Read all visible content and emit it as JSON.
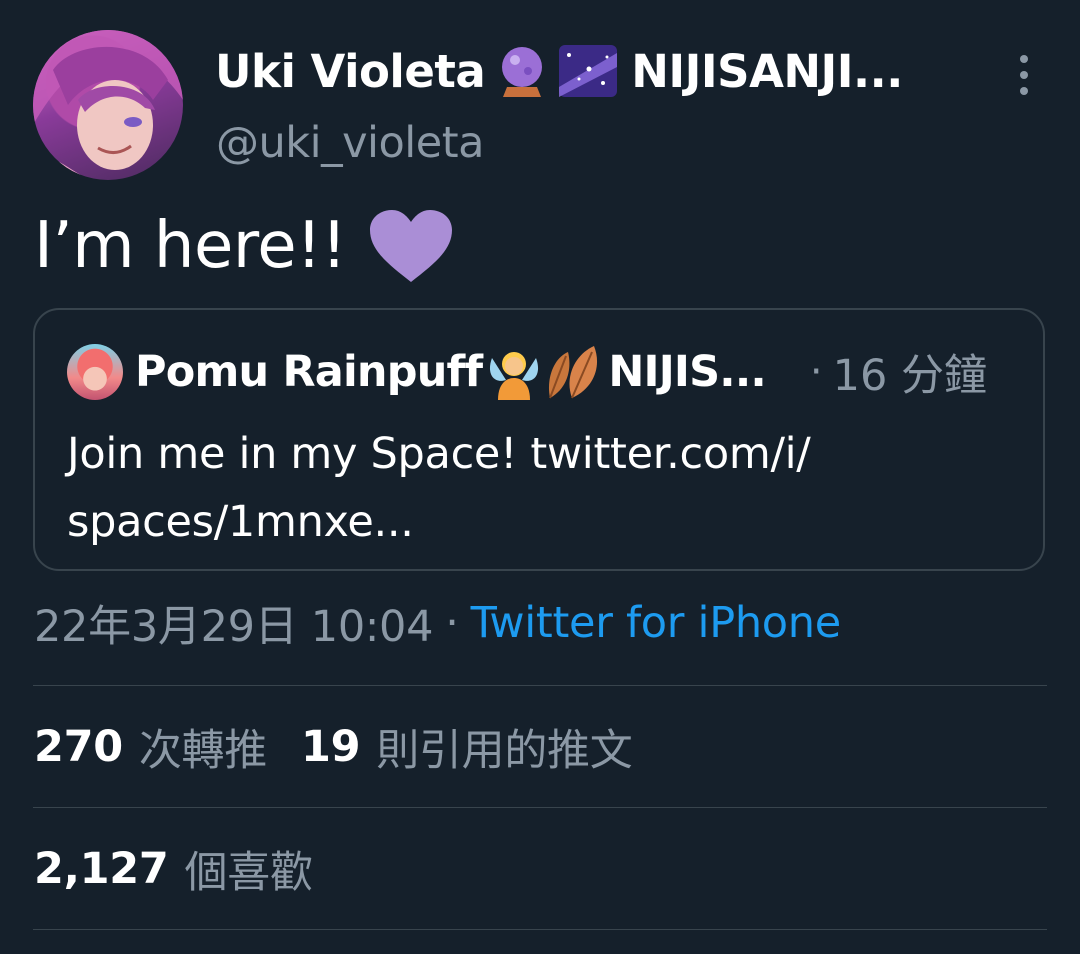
{
  "author": {
    "display_name": "Uki Violeta",
    "org": "NIJISANJI...",
    "handle": "@uki_violeta",
    "emoji": [
      "crystal-ball-icon",
      "milky-way-icon"
    ]
  },
  "tweet": {
    "text": "I’m here!!",
    "emoji": "purple-heart-icon"
  },
  "quoted": {
    "name": "Pomu Rainpuff",
    "org": "NIJIS...",
    "separator": "·",
    "time": "16 分鐘",
    "body_line1": "Join me in my Space! twitter.com/i/",
    "body_line2": "spaces/1mnxe...",
    "emoji": [
      "fairy-icon",
      "fallen-leaves-icon"
    ]
  },
  "meta": {
    "date": "22年3月29日 10:04",
    "separator": "·",
    "source": "Twitter for iPhone"
  },
  "stats": {
    "retweets_count": "270",
    "retweets_label": "次轉推",
    "quotes_count": "19",
    "quotes_label": "則引用的推文",
    "likes_count": "2,127",
    "likes_label": "個喜歡"
  },
  "colors": {
    "background": "#15202b",
    "text": "#ffffff",
    "muted": "#8b98a5",
    "link": "#1d9bf0",
    "border": "#38444d",
    "heart": "#aa8ed6"
  }
}
